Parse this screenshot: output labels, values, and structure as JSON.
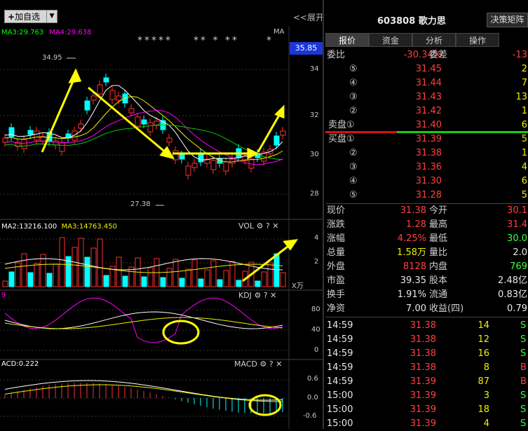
{
  "toolbar": {
    "add_label": "加自选",
    "expand_label": "<<展开"
  },
  "chart": {
    "ma3": "MA3:29.763",
    "ma4": "MA4:29.638",
    "ma_tag": "MA",
    "stars_a": "*****",
    "stars_b": "** * **",
    "stars_c": "*",
    "current_price": "35.85",
    "high_label": "34.95",
    "low_label": "27.38",
    "price_ticks": [
      "34",
      "32",
      "30",
      "28"
    ],
    "vol_legend_a": "MA2:13216.100",
    "vol_legend_b": "MA3:14763.450",
    "vol_name": "VOL",
    "vol_ticks": [
      "4",
      "2"
    ],
    "vol_unit": "X万",
    "kdj_value": "9",
    "kdj_name": "KDJ",
    "kdj_ticks": [
      "80",
      "40",
      "0"
    ],
    "macd_value": "ACD:0.222",
    "macd_name": "MACD",
    "macd_ticks": [
      "0.6",
      "0.0",
      "-0.6"
    ],
    "colors": {
      "up": "#ff3030",
      "down": "#00ffff",
      "ma_white": "#ffffff",
      "ma_yellow": "#f0f000",
      "ma_magenta": "#ff00ff",
      "ma_green": "#00d000",
      "arrow": "#ffff00"
    }
  },
  "stock": {
    "code": "603808",
    "name": "歌力思",
    "decision_btn": "决策矩阵"
  },
  "tabs": [
    "报价",
    "资金",
    "分析",
    "操作"
  ],
  "weibi": {
    "l1": "委比",
    "v1": "-30.34%",
    "l2": "委差",
    "v2": "-13"
  },
  "asks": [
    {
      "lvl": "⑤",
      "price": "31.45",
      "vol": "2"
    },
    {
      "lvl": "④",
      "price": "31.44",
      "vol": "7"
    },
    {
      "lvl": "③",
      "price": "31.43",
      "vol": "13"
    },
    {
      "lvl": "②",
      "price": "31.42",
      "vol": "1"
    },
    {
      "lvl": "卖盘①",
      "price": "31.40",
      "vol": "6"
    }
  ],
  "bids": [
    {
      "lvl": "买盘①",
      "price": "31.39",
      "vol": "5"
    },
    {
      "lvl": "②",
      "price": "31.38",
      "vol": "1"
    },
    {
      "lvl": "③",
      "price": "31.36",
      "vol": "4"
    },
    {
      "lvl": "④",
      "price": "31.30",
      "vol": "6"
    },
    {
      "lvl": "⑤",
      "price": "31.28",
      "vol": "5"
    }
  ],
  "quote": [
    {
      "l1": "现价",
      "v1": "31.38",
      "c1": "red",
      "l2": "今开",
      "v2": "30.1",
      "c2": "red"
    },
    {
      "l1": "涨跌",
      "v1": "1.28",
      "c1": "red",
      "l2": "最高",
      "v2": "31.4",
      "c2": "red"
    },
    {
      "l1": "涨幅",
      "v1": "4.25%",
      "c1": "red",
      "l2": "最低",
      "v2": "30.0",
      "c2": "green"
    },
    {
      "l1": "总量",
      "v1": "1.58万",
      "c1": "yellow",
      "l2": "量比",
      "v2": "2.0",
      "c2": "white"
    },
    {
      "l1": "外盘",
      "v1": "8128",
      "c1": "red",
      "l2": "内盘",
      "v2": "769",
      "c2": "green"
    },
    {
      "l1": "市盈",
      "v1": "39.35",
      "c1": "white",
      "l2": "股本",
      "v2": "2.48亿",
      "c2": "white"
    },
    {
      "l1": "换手",
      "v1": "1.91%",
      "c1": "white",
      "l2": "流通",
      "v2": "0.83亿",
      "c2": "white"
    },
    {
      "l1": "净资",
      "v1": "7.00",
      "c1": "white",
      "l2": "收益(四)",
      "v2": "0.79",
      "c2": "white"
    }
  ],
  "ticks": [
    {
      "t": "14:59",
      "p": "31.38",
      "v": "14",
      "s": "S",
      "sc": "green"
    },
    {
      "t": "14:59",
      "p": "31.38",
      "v": "12",
      "s": "S",
      "sc": "green"
    },
    {
      "t": "14:59",
      "p": "31.38",
      "v": "16",
      "s": "S",
      "sc": "green"
    },
    {
      "t": "14:59",
      "p": "31.38",
      "v": "8",
      "s": "B",
      "sc": "red"
    },
    {
      "t": "14:59",
      "p": "31.39",
      "v": "87",
      "s": "B",
      "sc": "red"
    },
    {
      "t": "15:00",
      "p": "31.39",
      "v": "3",
      "s": "S",
      "sc": "green"
    },
    {
      "t": "15:00",
      "p": "31.39",
      "v": "18",
      "s": "S",
      "sc": "green"
    },
    {
      "t": "15:00",
      "p": "31.39",
      "v": "4",
      "s": "S",
      "sc": "green"
    }
  ]
}
